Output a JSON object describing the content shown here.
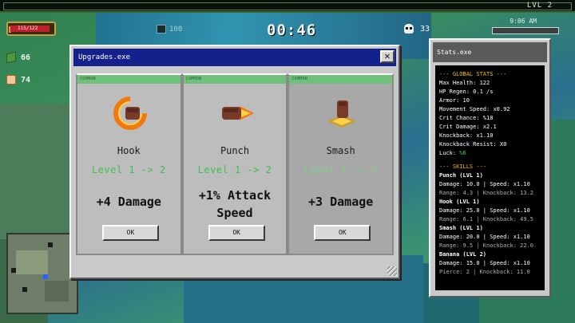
{
  "hud": {
    "level": "LVL 2",
    "clock": "9:06 AM",
    "health_text": "115/122",
    "health_fraction": 0.94,
    "money": "66",
    "food": "74",
    "chest_count": "100",
    "timer": "00:46",
    "kills": "33"
  },
  "upgrades_window": {
    "title": "Upgrades.exe",
    "close_label": "✕",
    "cards": [
      {
        "rarity": "COMMON",
        "icon": "hook-fist-icon",
        "name": "Hook",
        "level": "Level 1 -> 2",
        "effect": "+4 Damage",
        "button": "OK"
      },
      {
        "rarity": "COMMON",
        "icon": "punch-fist-icon",
        "name": "Punch",
        "level": "Level 1 -> 2",
        "effect_line1": "+1% Attack",
        "effect_line2": "Speed",
        "button": "OK"
      },
      {
        "rarity": "COMMON",
        "icon": "smash-fist-icon",
        "name": "Smash",
        "level": "Level 1 -> 2",
        "effect": "+3 Damage",
        "button": "OK"
      }
    ]
  },
  "stats_window": {
    "title": "Stats.exe",
    "global_header": "--- GLOBAL STATS ---",
    "global": [
      {
        "label": "Max Health: ",
        "value": "122"
      },
      {
        "label": "HP Regen: ",
        "value": "0.1 /s"
      },
      {
        "label": "Armor: ",
        "value": "10"
      },
      {
        "label": "Movement Speed: ",
        "value": "x0.92"
      },
      {
        "label": "Crit Chance: ",
        "value": "%18"
      },
      {
        "label": "Crit Damage: ",
        "value": "x2.1"
      },
      {
        "label": "Knockback: ",
        "value": "x1.10"
      },
      {
        "label": "Knockback Resist: ",
        "value": "X0"
      },
      {
        "label": "Luck: ",
        "value": "%6"
      }
    ],
    "skills_header": "--- SKILLS ---",
    "skills": [
      {
        "name": "Punch (LVL 1)",
        "line1": "Damage: 10.0 | Speed: x1.10",
        "line2": "Range: 4.3 | Knockback: 13.2"
      },
      {
        "name": "Hook (LVL 1)",
        "line1": "Damage: 25.0 | Speed: x1.10",
        "line2": "Range: 6.1 | Knockback: 49.5"
      },
      {
        "name": "Smash (LVL 1)",
        "line1": "Damage: 20.0 | Speed: x1.10",
        "line2": "Range: 9.5 | Knockback: 22.0"
      },
      {
        "name": "Banana (LVL 2)",
        "line1": "Damage: 15.0 | Speed: x1.10",
        "line2": "Pierce: 2 | Knockback: 11.0"
      }
    ]
  },
  "colors": {
    "title_bar": "#15218a",
    "rarity_common": "#6fc07a",
    "level_text": "#3fbf4f",
    "stats_accent": "#f0c000"
  }
}
